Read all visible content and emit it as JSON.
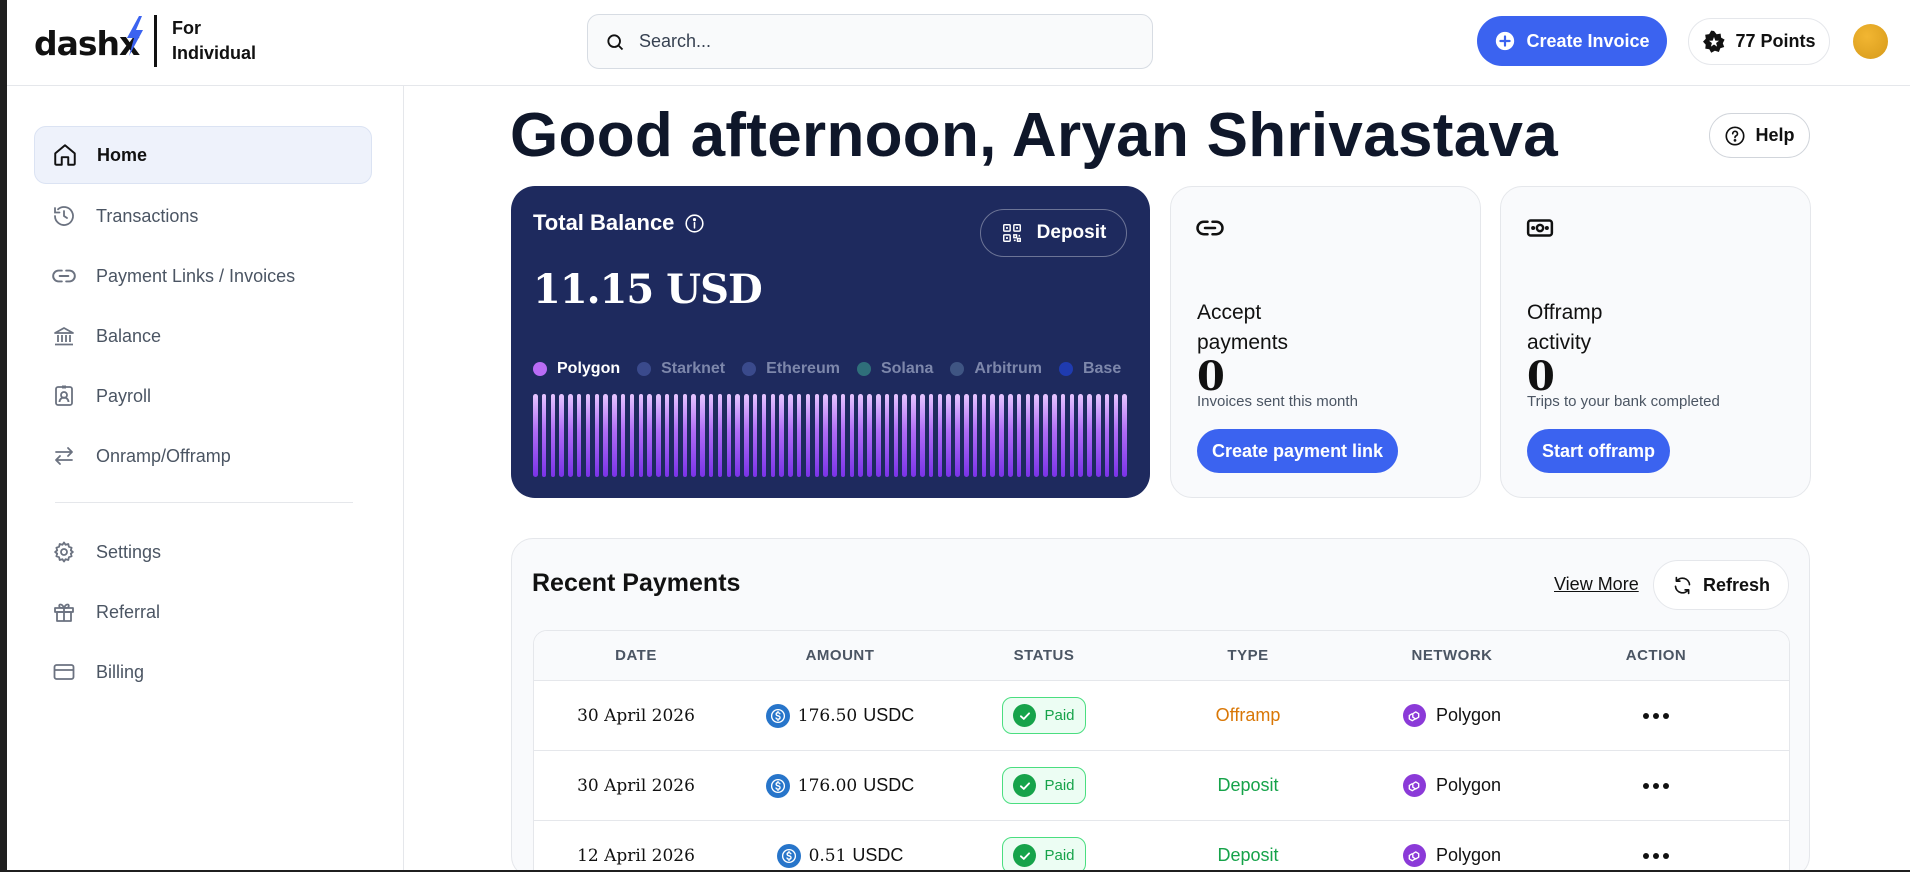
{
  "header": {
    "logo_text": "dash",
    "logo_x": "x",
    "tagline_line1": "For",
    "tagline_line2": "Individual",
    "search_placeholder": "Search...",
    "create_invoice_label": "Create Invoice",
    "points_label": "77 Points"
  },
  "sidebar": {
    "items": [
      {
        "label": "Home",
        "icon": "home-icon",
        "active": true
      },
      {
        "label": "Transactions",
        "icon": "history-icon"
      },
      {
        "label": "Payment Links / Invoices",
        "icon": "link-icon"
      },
      {
        "label": "Balance",
        "icon": "bank-icon"
      },
      {
        "label": "Payroll",
        "icon": "badge-icon"
      },
      {
        "label": "Onramp/Offramp",
        "icon": "swap-icon"
      },
      {
        "label": "Settings",
        "icon": "gear-icon"
      },
      {
        "label": "Referral",
        "icon": "gift-icon"
      },
      {
        "label": "Billing",
        "icon": "credit-card-icon"
      }
    ]
  },
  "main": {
    "greeting": "Good afternoon, Aryan Shrivastava",
    "help_label": "Help",
    "balance": {
      "title": "Total Balance",
      "amount": "11.15 USD",
      "deposit_label": "Deposit",
      "networks": [
        {
          "name": "Polygon",
          "color": "#b96cf5",
          "active": true
        },
        {
          "name": "Starknet",
          "color": "#3a4a8c"
        },
        {
          "name": "Ethereum",
          "color": "#3a4a8c"
        },
        {
          "name": "Solana",
          "color": "#2f6f7a"
        },
        {
          "name": "Arbitrum",
          "color": "#3f5583"
        },
        {
          "name": "Base",
          "color": "#1f3bb0"
        }
      ]
    },
    "accept": {
      "title": "Accept payments",
      "count": "0",
      "subtitle": "Invoices sent this month",
      "button": "Create payment link"
    },
    "offramp": {
      "title": "Offramp activity",
      "count": "0",
      "subtitle": "Trips to your bank completed",
      "button": "Start offramp"
    },
    "payments": {
      "title": "Recent Payments",
      "view_more": "View More",
      "refresh": "Refresh",
      "columns": [
        "DATE",
        "AMOUNT",
        "STATUS",
        "TYPE",
        "NETWORK",
        "ACTION"
      ],
      "rows": [
        {
          "date": "30 April 2026",
          "amount": "176.50",
          "currency": "USDC",
          "status": "Paid",
          "type": "Offramp",
          "network": "Polygon"
        },
        {
          "date": "30 April 2026",
          "amount": "176.00",
          "currency": "USDC",
          "status": "Paid",
          "type": "Deposit",
          "network": "Polygon"
        },
        {
          "date": "12 April 2026",
          "amount": "0.51",
          "currency": "USDC",
          "status": "Paid",
          "type": "Deposit",
          "network": "Polygon"
        }
      ]
    }
  },
  "colors": {
    "accent": "#3b63f0",
    "balance_card": "#1e2a5e",
    "paid_green": "#16a34a",
    "offramp_orange": "#d97706"
  }
}
